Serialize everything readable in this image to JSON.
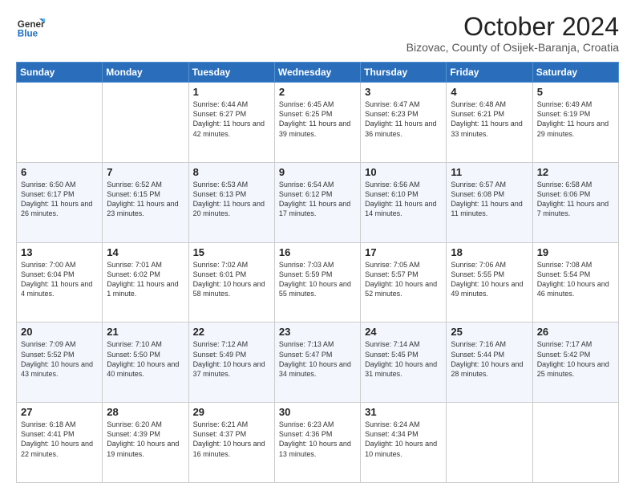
{
  "header": {
    "logo_line1": "General",
    "logo_line2": "Blue",
    "title": "October 2024",
    "subtitle": "Bizovac, County of Osijek-Baranja, Croatia"
  },
  "columns": [
    "Sunday",
    "Monday",
    "Tuesday",
    "Wednesday",
    "Thursday",
    "Friday",
    "Saturday"
  ],
  "weeks": [
    [
      {
        "day": "",
        "info": ""
      },
      {
        "day": "",
        "info": ""
      },
      {
        "day": "1",
        "info": "Sunrise: 6:44 AM\nSunset: 6:27 PM\nDaylight: 11 hours and 42 minutes."
      },
      {
        "day": "2",
        "info": "Sunrise: 6:45 AM\nSunset: 6:25 PM\nDaylight: 11 hours and 39 minutes."
      },
      {
        "day": "3",
        "info": "Sunrise: 6:47 AM\nSunset: 6:23 PM\nDaylight: 11 hours and 36 minutes."
      },
      {
        "day": "4",
        "info": "Sunrise: 6:48 AM\nSunset: 6:21 PM\nDaylight: 11 hours and 33 minutes."
      },
      {
        "day": "5",
        "info": "Sunrise: 6:49 AM\nSunset: 6:19 PM\nDaylight: 11 hours and 29 minutes."
      }
    ],
    [
      {
        "day": "6",
        "info": "Sunrise: 6:50 AM\nSunset: 6:17 PM\nDaylight: 11 hours and 26 minutes."
      },
      {
        "day": "7",
        "info": "Sunrise: 6:52 AM\nSunset: 6:15 PM\nDaylight: 11 hours and 23 minutes."
      },
      {
        "day": "8",
        "info": "Sunrise: 6:53 AM\nSunset: 6:13 PM\nDaylight: 11 hours and 20 minutes."
      },
      {
        "day": "9",
        "info": "Sunrise: 6:54 AM\nSunset: 6:12 PM\nDaylight: 11 hours and 17 minutes."
      },
      {
        "day": "10",
        "info": "Sunrise: 6:56 AM\nSunset: 6:10 PM\nDaylight: 11 hours and 14 minutes."
      },
      {
        "day": "11",
        "info": "Sunrise: 6:57 AM\nSunset: 6:08 PM\nDaylight: 11 hours and 11 minutes."
      },
      {
        "day": "12",
        "info": "Sunrise: 6:58 AM\nSunset: 6:06 PM\nDaylight: 11 hours and 7 minutes."
      }
    ],
    [
      {
        "day": "13",
        "info": "Sunrise: 7:00 AM\nSunset: 6:04 PM\nDaylight: 11 hours and 4 minutes."
      },
      {
        "day": "14",
        "info": "Sunrise: 7:01 AM\nSunset: 6:02 PM\nDaylight: 11 hours and 1 minute."
      },
      {
        "day": "15",
        "info": "Sunrise: 7:02 AM\nSunset: 6:01 PM\nDaylight: 10 hours and 58 minutes."
      },
      {
        "day": "16",
        "info": "Sunrise: 7:03 AM\nSunset: 5:59 PM\nDaylight: 10 hours and 55 minutes."
      },
      {
        "day": "17",
        "info": "Sunrise: 7:05 AM\nSunset: 5:57 PM\nDaylight: 10 hours and 52 minutes."
      },
      {
        "day": "18",
        "info": "Sunrise: 7:06 AM\nSunset: 5:55 PM\nDaylight: 10 hours and 49 minutes."
      },
      {
        "day": "19",
        "info": "Sunrise: 7:08 AM\nSunset: 5:54 PM\nDaylight: 10 hours and 46 minutes."
      }
    ],
    [
      {
        "day": "20",
        "info": "Sunrise: 7:09 AM\nSunset: 5:52 PM\nDaylight: 10 hours and 43 minutes."
      },
      {
        "day": "21",
        "info": "Sunrise: 7:10 AM\nSunset: 5:50 PM\nDaylight: 10 hours and 40 minutes."
      },
      {
        "day": "22",
        "info": "Sunrise: 7:12 AM\nSunset: 5:49 PM\nDaylight: 10 hours and 37 minutes."
      },
      {
        "day": "23",
        "info": "Sunrise: 7:13 AM\nSunset: 5:47 PM\nDaylight: 10 hours and 34 minutes."
      },
      {
        "day": "24",
        "info": "Sunrise: 7:14 AM\nSunset: 5:45 PM\nDaylight: 10 hours and 31 minutes."
      },
      {
        "day": "25",
        "info": "Sunrise: 7:16 AM\nSunset: 5:44 PM\nDaylight: 10 hours and 28 minutes."
      },
      {
        "day": "26",
        "info": "Sunrise: 7:17 AM\nSunset: 5:42 PM\nDaylight: 10 hours and 25 minutes."
      }
    ],
    [
      {
        "day": "27",
        "info": "Sunrise: 6:18 AM\nSunset: 4:41 PM\nDaylight: 10 hours and 22 minutes."
      },
      {
        "day": "28",
        "info": "Sunrise: 6:20 AM\nSunset: 4:39 PM\nDaylight: 10 hours and 19 minutes."
      },
      {
        "day": "29",
        "info": "Sunrise: 6:21 AM\nSunset: 4:37 PM\nDaylight: 10 hours and 16 minutes."
      },
      {
        "day": "30",
        "info": "Sunrise: 6:23 AM\nSunset: 4:36 PM\nDaylight: 10 hours and 13 minutes."
      },
      {
        "day": "31",
        "info": "Sunrise: 6:24 AM\nSunset: 4:34 PM\nDaylight: 10 hours and 10 minutes."
      },
      {
        "day": "",
        "info": ""
      },
      {
        "day": "",
        "info": ""
      }
    ]
  ]
}
